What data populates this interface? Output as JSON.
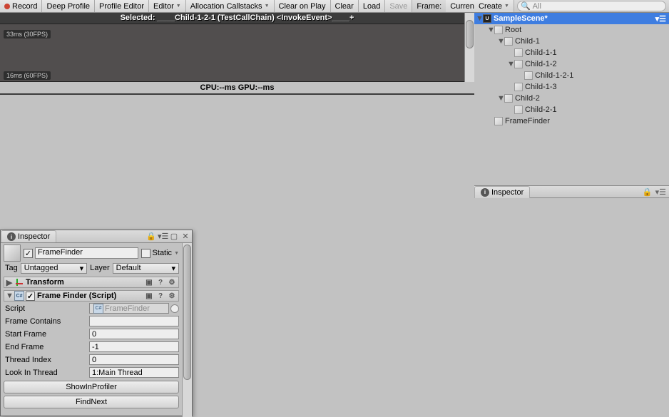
{
  "profiler_toolbar": {
    "record": "Record",
    "deep_profile": "Deep Profile",
    "profile_editor": "Profile Editor",
    "editor": "Editor",
    "alloc_cs": "Allocation Callstacks",
    "clear_play": "Clear on Play",
    "clear": "Clear",
    "load": "Load",
    "save": "Save",
    "frame": "Frame:",
    "current": "Curren"
  },
  "profiler_header": "Selected: ____Child-1-2-1 (TestCallChain) <InvokeEvent>____+",
  "fps33": "33ms (30FPS)",
  "fps60": "16ms (60FPS)",
  "profiler_stats": "CPU:--ms   GPU:--ms",
  "hierarchy_toolbar": {
    "create": "Create",
    "search_placeholder": "All"
  },
  "scene_name": "SampleScene*",
  "tree": [
    {
      "indent": 1,
      "fold": "▼",
      "name": "Root"
    },
    {
      "indent": 2,
      "fold": "▼",
      "name": "Child-1"
    },
    {
      "indent": 3,
      "fold": "",
      "name": "Child-1-1"
    },
    {
      "indent": 3,
      "fold": "▼",
      "name": "Child-1-2"
    },
    {
      "indent": 4,
      "fold": "",
      "name": "Child-1-2-1"
    },
    {
      "indent": 3,
      "fold": "",
      "name": "Child-1-3"
    },
    {
      "indent": 2,
      "fold": "▼",
      "name": "Child-2"
    },
    {
      "indent": 3,
      "fold": "",
      "name": "Child-2-1"
    },
    {
      "indent": 1,
      "fold": "",
      "name": "FrameFinder"
    }
  ],
  "inspector_tab": "Inspector",
  "go": {
    "enabled": true,
    "name": "FrameFinder",
    "static_label": "Static",
    "tag_label": "Tag",
    "tag_value": "Untagged",
    "layer_label": "Layer",
    "layer_value": "Default"
  },
  "transform_header": "Transform",
  "script_header": "Frame Finder (Script)",
  "fields": {
    "script_label": "Script",
    "script_value": "FrameFinder",
    "frame_contains_label": "Frame Contains",
    "frame_contains_value": "",
    "start_frame_label": "Start Frame",
    "start_frame_value": "0",
    "end_frame_label": "End Frame",
    "end_frame_value": "-1",
    "thread_index_label": "Thread Index",
    "thread_index_value": "0",
    "look_in_thread_label": "Look In Thread",
    "look_in_thread_value": "1:Main Thread"
  },
  "btn_show": "ShowInProfiler",
  "btn_findnext": "FindNext"
}
